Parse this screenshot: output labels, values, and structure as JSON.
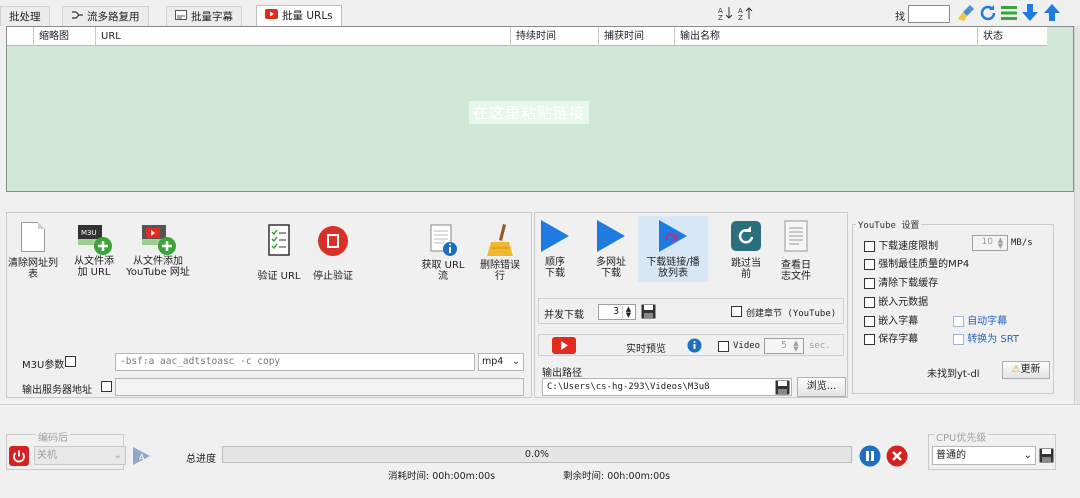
{
  "tabs": [
    {
      "label": "批处理",
      "icon": "none"
    },
    {
      "label": "流多路复用",
      "icon": "mux-icon"
    },
    {
      "label": "批量字幕",
      "icon": "subtitle-icon"
    },
    {
      "label": "批量 URLs",
      "icon": "youtube-icon",
      "active": true
    }
  ],
  "toolbar": {
    "find_label": "找",
    "find_value": ""
  },
  "table": {
    "columns": [
      "缩略图",
      "URL",
      "持续时间",
      "捕获时间",
      "输出名称",
      "状态"
    ],
    "placeholder": "在这里粘贴链接"
  },
  "left_actions": {
    "clear_list": "清除网址列表",
    "add_from_file_line1": "从文件添",
    "add_from_file_line2": "加 URL",
    "add_youtube_line1": "从文件添加",
    "add_youtube_line2": "YouTube 网址",
    "verify_url": "验证 URL",
    "stop_verify": "停止验证",
    "get_url_stream_line1": "获取 URL",
    "get_url_stream_line2": "流",
    "delete_errors_line1": "删除错误",
    "delete_errors_line2": "行"
  },
  "m3u": {
    "label": "M3U参数",
    "value": "-bsf:a aac_adtstoasc -c copy",
    "format": "mp4"
  },
  "output_server": {
    "label": "输出服务器地址",
    "value": ""
  },
  "download": {
    "sequential_line1": "顺序",
    "sequential_line2": "下载",
    "multi_line1": "多网址",
    "multi_line2": "下载",
    "playlist_line1": "下载链接/播",
    "playlist_line2": "放列表",
    "skip_line1": "跳过当",
    "skip_line2": "前",
    "log_line1": "查看日",
    "log_line2": "志文件",
    "concurrent_label": "并发下载",
    "concurrent_value": "3",
    "create_chapters": "创建章节 (YouTube)",
    "preview_label": "实时预览",
    "video_label": "Video",
    "video_seconds": "5",
    "sec_label": "sec.",
    "output_path_label": "输出路径",
    "output_path": "C:\\Users\\cs-hg-293\\Videos\\M3u8",
    "browse": "浏览..."
  },
  "youtube_settings": {
    "title": "YouTube 设置",
    "speed_limit": "下载速度限制",
    "speed_value": "10",
    "speed_unit": "MB/s",
    "force_best": "强制最佳质量的MP4",
    "clear_cache": "清除下载缓存",
    "embed_metadata": "嵌入元数据",
    "embed_subs": "嵌入字幕",
    "auto_subs": "自动字幕",
    "save_subs": "保存字幕",
    "convert_srt": "转换为 SRT",
    "ytdl_status": "未找到yt-dl",
    "update": "更新"
  },
  "footer": {
    "after_encode_label": "编码后",
    "after_encode_value": "关机",
    "total_progress_label": "总进度",
    "progress_text": "0.0%",
    "progress_value": 0.0,
    "elapsed": "消耗时间: 00h:00m:00s",
    "remaining": "剩余时间: 00h:00m:00s",
    "cpu_priority_label": "CPU优先级",
    "cpu_priority_value": "普通的"
  },
  "colors": {
    "grid_bg": "#cfe9d6",
    "accent_blue": "#1e7be0",
    "youtube_red": "#e22a1f",
    "green": "#3aa537"
  }
}
